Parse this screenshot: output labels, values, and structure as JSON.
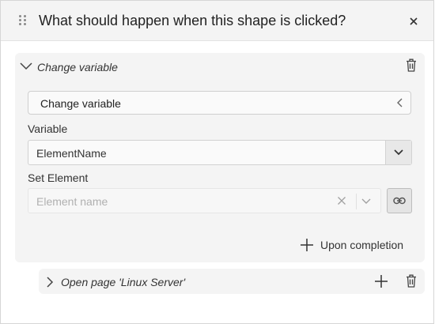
{
  "dialog": {
    "title": "What should happen when this shape is clicked?"
  },
  "action": {
    "title": "Change variable",
    "action_type_value": "Change variable",
    "variable_label": "Variable",
    "variable_value": "ElementName",
    "set_element_label": "Set Element",
    "set_element_placeholder": "Element name",
    "upon_completion_label": "Upon completion"
  },
  "next_action": {
    "title": "Open page 'Linux Server'"
  },
  "icons": {
    "drag": "drag-handle-icon",
    "close": "close-icon",
    "collapse": "chevron-down-icon",
    "expand": "chevron-right-icon",
    "delete": "trash-icon",
    "select_arrow": "chevron-left-icon",
    "dropdown": "chevron-down-icon",
    "clear": "close-icon",
    "link": "link-icon",
    "add": "plus-icon"
  }
}
